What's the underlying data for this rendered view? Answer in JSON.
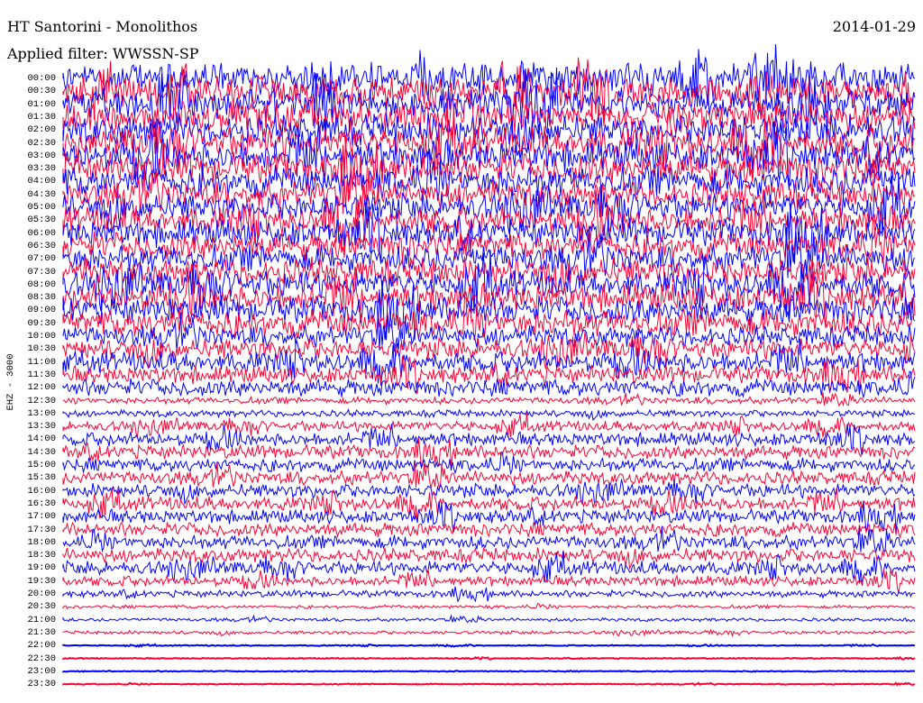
{
  "header": {
    "station": "HT Santorini - Monolithos",
    "filter_label": "Applied filter: WWSSN-SP",
    "date": "2014-01-29"
  },
  "channel_label": "EHZ - 3000",
  "colors": {
    "trace_a": "#0000ff",
    "trace_b": "#ff0033",
    "background": "#ffffff"
  },
  "chart_data": {
    "type": "line",
    "title": "HT Santorini - Monolithos",
    "subtitle": "Applied filter: WWSSN-SP",
    "date": "2014-01-29",
    "ylabel": "EHZ - 3000",
    "row_labels": [
      "00:00",
      "00:30",
      "01:00",
      "01:30",
      "02:00",
      "02:30",
      "03:00",
      "03:30",
      "04:00",
      "04:30",
      "05:00",
      "05:30",
      "06:00",
      "06:30",
      "07:00",
      "07:30",
      "08:00",
      "08:30",
      "09:00",
      "09:30",
      "10:00",
      "10:30",
      "11:00",
      "11:30",
      "12:00",
      "12:30",
      "13:00",
      "13:30",
      "14:00",
      "14:30",
      "15:00",
      "15:30",
      "16:00",
      "16:30",
      "17:00",
      "17:30",
      "18:00",
      "18:30",
      "19:00",
      "19:30",
      "20:00",
      "20:30",
      "21:00",
      "21:30",
      "22:00",
      "22:30",
      "23:00",
      "23:30"
    ],
    "relative_amplitude": [
      9,
      9,
      9,
      9,
      9,
      9,
      9,
      9,
      9,
      8,
      8,
      8,
      8,
      8,
      8,
      8,
      8,
      8,
      8,
      8,
      6,
      6,
      6,
      5,
      5,
      2,
      2,
      3,
      4,
      4,
      4,
      4,
      4,
      4,
      4,
      4,
      4,
      4,
      4,
      3,
      2,
      1,
      1,
      1,
      0.3,
      0.3,
      0.3,
      0.3
    ],
    "trace_colors": [
      "blue",
      "red"
    ]
  }
}
